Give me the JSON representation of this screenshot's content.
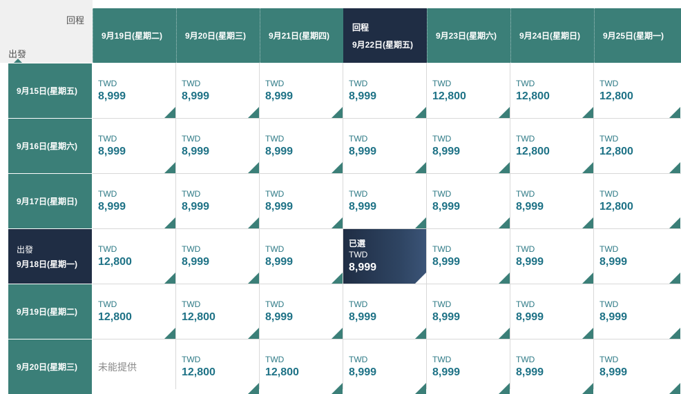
{
  "labels": {
    "return": "回程",
    "depart": "出發",
    "selected": "已選",
    "unavailable": "未能提供"
  },
  "return_dates": [
    {
      "date": "9月19日(星期二)"
    },
    {
      "date": "9月20日(星期三)"
    },
    {
      "date": "9月21日(星期四)"
    },
    {
      "date": "9月22日(星期五)",
      "selected": true,
      "sub": "回程"
    },
    {
      "date": "9月23日(星期六)"
    },
    {
      "date": "9月24日(星期日)"
    },
    {
      "date": "9月25日(星期一)"
    }
  ],
  "depart_dates": [
    {
      "date": "9月15日(星期五)"
    },
    {
      "date": "9月16日(星期六)"
    },
    {
      "date": "9月17日(星期日)"
    },
    {
      "date": "9月18日(星期一)",
      "selected": true,
      "sub": "出發"
    },
    {
      "date": "9月19日(星期二)"
    },
    {
      "date": "9月20日(星期三)"
    }
  ],
  "currency": "TWD",
  "prices": [
    [
      "8,999",
      "8,999",
      "8,999",
      "8,999",
      "12,800",
      "12,800",
      "12,800"
    ],
    [
      "8,999",
      "8,999",
      "8,999",
      "8,999",
      "8,999",
      "12,800",
      "12,800"
    ],
    [
      "8,999",
      "8,999",
      "8,999",
      "8,999",
      "8,999",
      "8,999",
      "12,800"
    ],
    [
      "12,800",
      "8,999",
      "8,999",
      "8,999",
      "8,999",
      "8,999",
      "8,999"
    ],
    [
      "12,800",
      "12,800",
      "8,999",
      "8,999",
      "8,999",
      "8,999",
      "8,999"
    ],
    [
      null,
      "12,800",
      "12,800",
      "8,999",
      "8,999",
      "8,999",
      "8,999"
    ]
  ],
  "selected_cell": {
    "row": 3,
    "col": 3
  },
  "colors": {
    "teal": "#3b7f78",
    "navy": "#1f2d44",
    "price": "#1e7286"
  }
}
